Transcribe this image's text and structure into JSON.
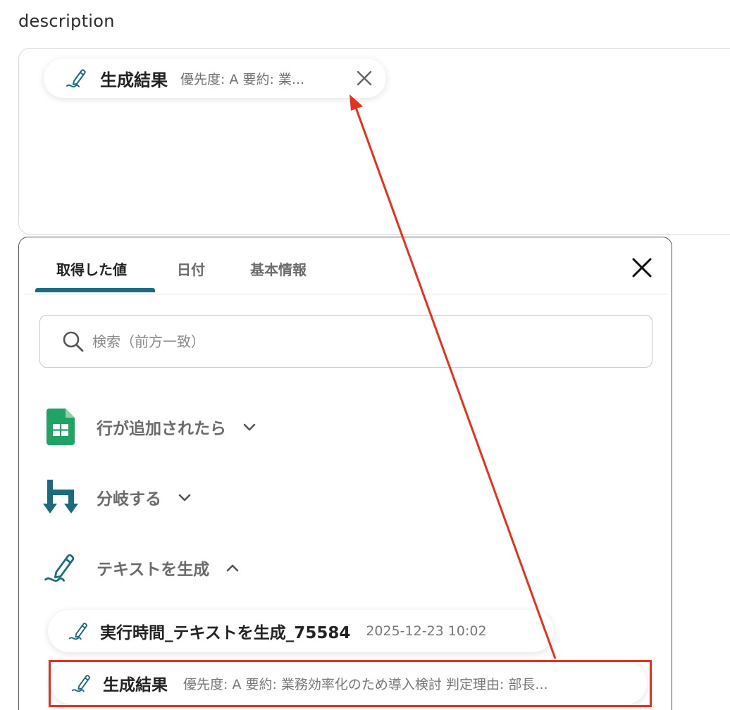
{
  "field": {
    "label": "description"
  },
  "chip": {
    "icon": "pen-line-icon",
    "title": "生成結果",
    "subtitle": "優先度: A 要約: 業...",
    "remove_icon": "close-icon"
  },
  "panel": {
    "tabs": [
      {
        "label": "取得した値",
        "active": true
      },
      {
        "label": "日付",
        "active": false
      },
      {
        "label": "基本情報",
        "active": false
      }
    ],
    "close_icon": "close-icon",
    "search": {
      "placeholder": "検索（前方一致）",
      "value": "",
      "icon": "search-icon"
    },
    "groups": [
      {
        "label": "行が追加されたら",
        "icon": "google-sheets-icon",
        "expanded": false,
        "chevron": "chevron-down-icon"
      },
      {
        "label": "分岐する",
        "icon": "branch-icon",
        "expanded": false,
        "chevron": "chevron-down-icon"
      },
      {
        "label": "テキストを生成",
        "icon": "pen-line-icon",
        "expanded": true,
        "chevron": "chevron-up-icon"
      }
    ],
    "items": [
      {
        "title": "実行時間_テキストを生成_75584",
        "value": "2025-12-23 10:02",
        "icon": "pen-line-icon"
      },
      {
        "title": "生成結果",
        "value": "優先度: A 要約: 業務効率化のため導入検討 判定理由: 部長...",
        "icon": "pen-line-icon",
        "highlighted": true
      }
    ]
  },
  "colors": {
    "accent": "#1a6b80",
    "annotation": "#e8301c",
    "sheets_green": "#1fa463"
  }
}
